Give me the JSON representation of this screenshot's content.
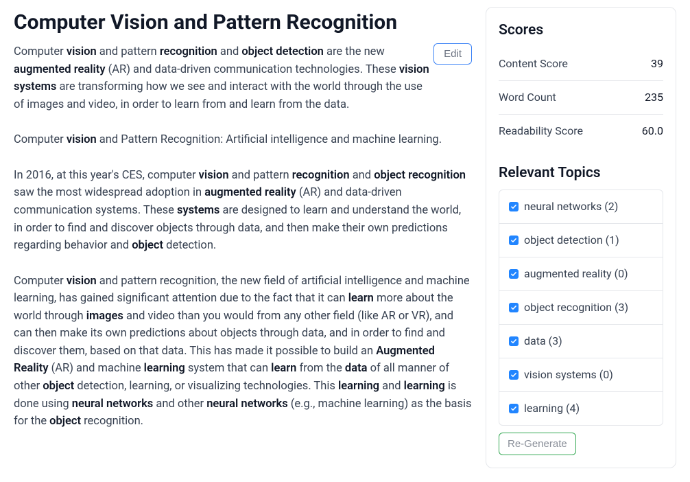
{
  "article": {
    "title": "Computer Vision and Pattern Recognition",
    "edit_label": "Edit",
    "p1": {
      "t1": "Computer ",
      "b1": "vision",
      "t2": " and pattern ",
      "b2": "recognition",
      "t3": " and ",
      "b3": "object detection",
      "t4": " are the new ",
      "b4": "augmented reality",
      "t5": " (AR) and data-driven communication technologies. These ",
      "b5": "vision systems",
      "t6": " are transforming how we see and interact with the world through the use of images and video, in order to learn from and learn from the data."
    },
    "p2": {
      "t1": "Computer ",
      "b1": "vision",
      "t2": " and Pattern Recognition: Artificial intelligence and machine learning."
    },
    "p3": {
      "t1": "In 2016, at this year's CES, computer ",
      "b1": "vision",
      "t2": " and pattern ",
      "b2": "recognition",
      "t3": " and ",
      "b3": "object recognition",
      "t4": " saw the most widespread adoption in ",
      "b4": "augmented reality",
      "t5": " (AR) and data-driven communication systems. These ",
      "b5": "systems",
      "t6": " are designed to learn and understand the world, in order to find and discover objects through data, and then make their own predictions regarding behavior and ",
      "b6": "object",
      "t7": " detection."
    },
    "p4": {
      "t1": "Computer ",
      "b1": "vision",
      "t2": " and pattern recognition, the new field of artificial intelligence and machine learning, has gained significant attention due to the fact that it can ",
      "b2": "learn",
      "t3": " more about the world through ",
      "b3": "images",
      "t4": " and video than you would from any other field (like AR or VR), and can then make its own predictions about objects through data, and in order to find and discover them, based on that data. This has made it possible to build an ",
      "b4": "Augmented Reality",
      "t5": " (AR) and machine ",
      "b5": "learning",
      "t6": " system that can ",
      "b6": "learn",
      "t7": " from the ",
      "b7": "data",
      "t8": " of all manner of other ",
      "b8": "object",
      "t9": " detection, learning, or visualizing technologies. This ",
      "b9": "learning",
      "t10": " and ",
      "b10": "learning",
      "t11": " is done using ",
      "b11": "neural networks",
      "t12": " and other ",
      "b12": "neural networks",
      "t13": " (e.g., machine learning) as the basis for the ",
      "b13": "object",
      "t14": " recognition."
    }
  },
  "sidebar": {
    "scores_title": "Scores",
    "scores": [
      {
        "label": "Content Score",
        "value": "39"
      },
      {
        "label": "Word Count",
        "value": "235"
      },
      {
        "label": "Readability Score",
        "value": "60.0"
      }
    ],
    "topics_title": "Relevant Topics",
    "topics": [
      {
        "label": "neural networks (2)",
        "checked": true
      },
      {
        "label": "object detection (1)",
        "checked": true
      },
      {
        "label": "augmented reality (0)",
        "checked": true
      },
      {
        "label": "object recognition (3)",
        "checked": true
      },
      {
        "label": "data (3)",
        "checked": true
      },
      {
        "label": "vision systems (0)",
        "checked": true
      },
      {
        "label": "learning (4)",
        "checked": true
      }
    ],
    "regenerate_label": "Re-Generate"
  }
}
